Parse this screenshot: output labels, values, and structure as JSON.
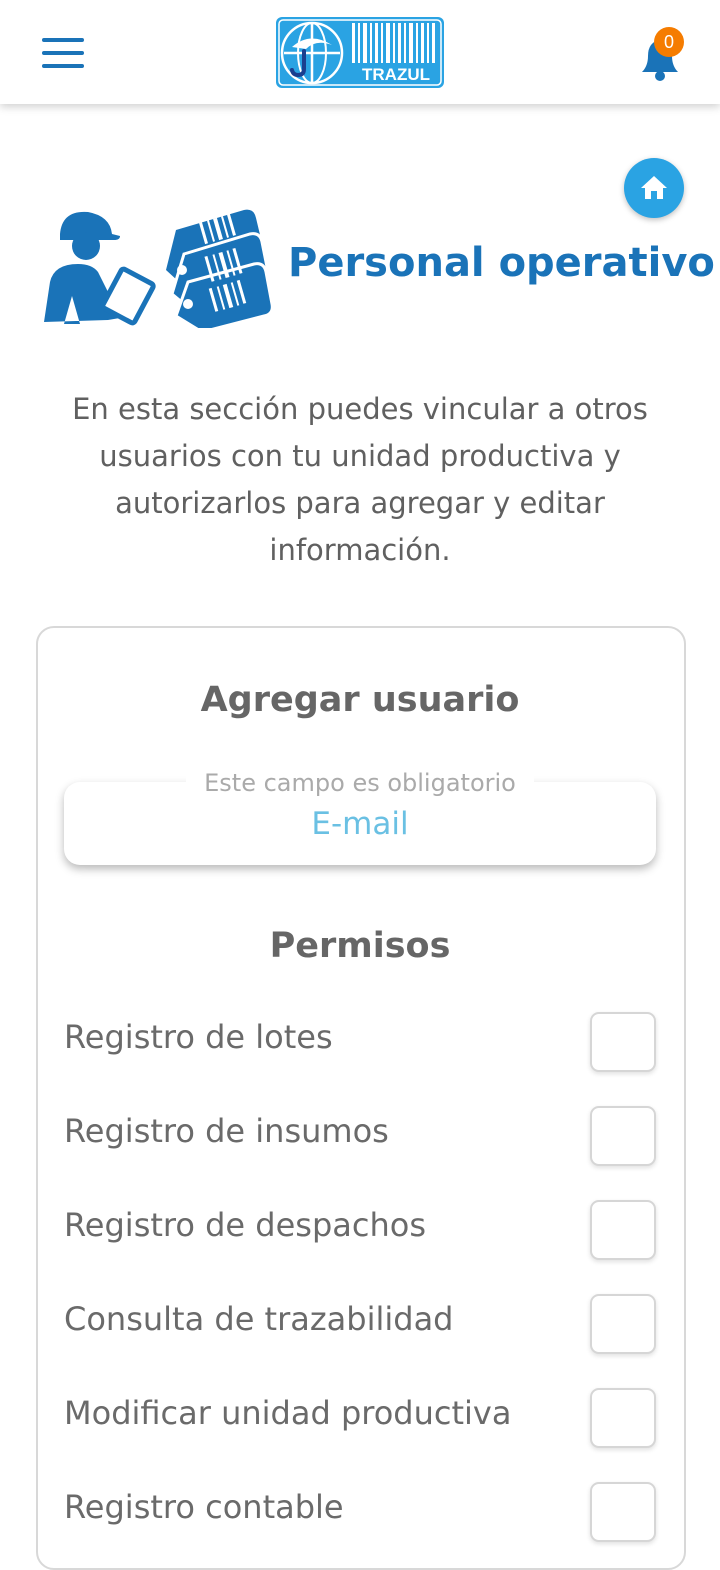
{
  "header": {
    "logo_text": "TRAZUL",
    "notifications_count": "0"
  },
  "hero": {
    "title": "Personal operativo",
    "intro": "En esta sección puedes vincular a otros usuarios con tu unidad productiva y autorizarlos para agregar y editar información."
  },
  "form": {
    "title": "Agregar usuario",
    "email_placeholder": "E-mail",
    "email_helper": "Este campo es obligatorio",
    "permissions_title": "Permisos",
    "permissions": [
      {
        "label": "Registro de lotes",
        "checked": false
      },
      {
        "label": "Registro de insumos",
        "checked": false
      },
      {
        "label": "Registro de despachos",
        "checked": false
      },
      {
        "label": "Consulta de trazabilidad",
        "checked": false
      },
      {
        "label": "Modificar unidad productiva",
        "checked": false
      },
      {
        "label": "Registro contable",
        "checked": false
      }
    ]
  },
  "colors": {
    "primary": "#1a73b8",
    "accent": "#2aa3e3",
    "badge": "#f57c00",
    "placeholder": "#6ac0e3"
  },
  "icons": {
    "menu": "hamburger-icon",
    "notifications": "bell-icon",
    "home": "home-icon"
  }
}
